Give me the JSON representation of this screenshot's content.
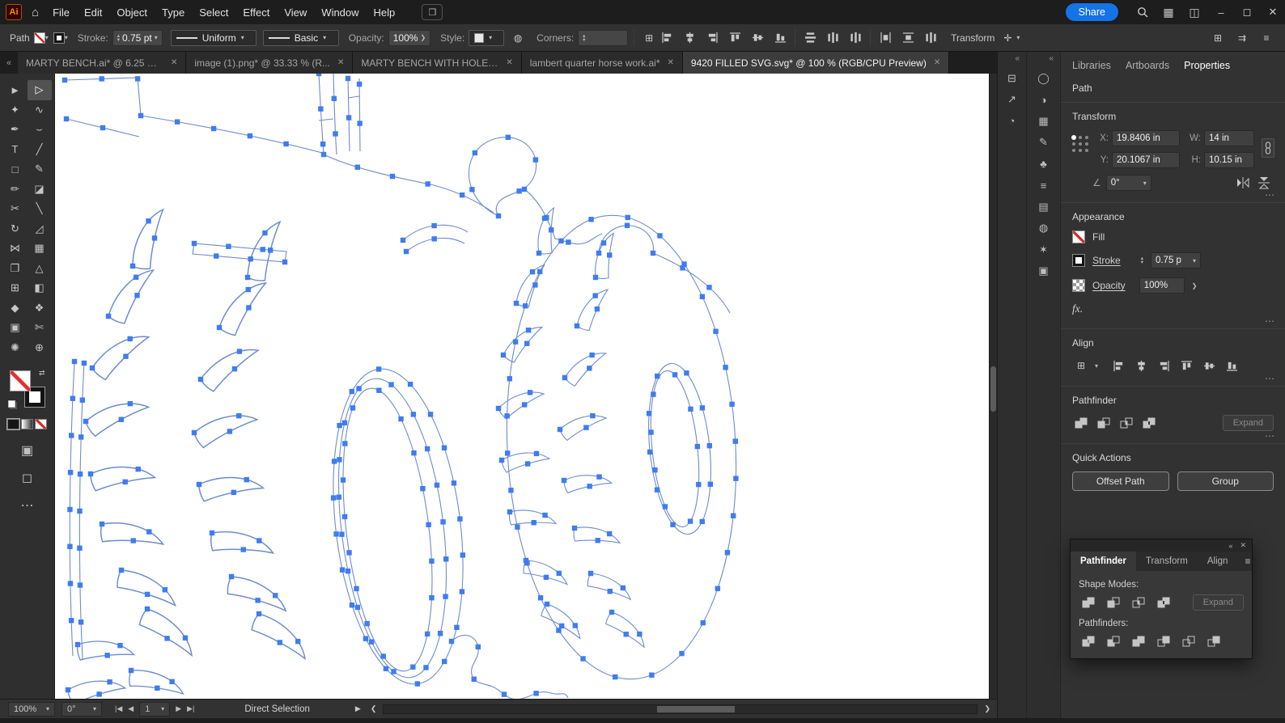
{
  "icon_glyphs": {
    "home": "⌂",
    "chevron_down": "▾",
    "up": "▴",
    "down": "▾",
    "collapse": "«",
    "more": "⋯",
    "swap": "⇄",
    "angle": "∠",
    "transform_each": "✛",
    "menu": "≡",
    "workspace": "▦",
    "panel_layout": "◫",
    "apps": "❒",
    "close": "✕",
    "grid": "⊞",
    "arrows": "⇉",
    "circle_icon": "◍",
    "first": "|◀",
    "prev": "◀",
    "next": "▶",
    "last": "▶|",
    "play": "▶",
    "scroll_left": "❮",
    "scroll_right": "❯",
    "draw_mode": "▣",
    "screen_mode": "◻"
  },
  "titlebar": {
    "logo": "Ai",
    "menus": [
      "File",
      "Edit",
      "Object",
      "Type",
      "Select",
      "Effect",
      "View",
      "Window",
      "Help"
    ],
    "share": "Share",
    "window_controls": {
      "minimize": "–",
      "maximize": "◻",
      "close": "✕"
    }
  },
  "controlbar": {
    "selection_type": "Path",
    "stroke_label": "Stroke:",
    "stroke_value": "0.75 pt",
    "width_profile": "Uniform",
    "brush": "Basic",
    "opacity_label": "Opacity:",
    "opacity_value": "100%",
    "style_label": "Style:",
    "corners_label": "Corners:",
    "transform_label": "Transform",
    "align_icons": [
      {
        "name": "align-left-icon",
        "kind": "h-left"
      },
      {
        "name": "align-center-horizontal-icon",
        "kind": "h-center"
      },
      {
        "name": "align-right-icon",
        "kind": "h-right"
      },
      {
        "name": "align-top-icon",
        "kind": "v-top"
      },
      {
        "name": "align-center-vertical-icon",
        "kind": "v-middle"
      },
      {
        "name": "align-bottom-icon",
        "kind": "v-bottom"
      }
    ],
    "distribute_icons": [
      {
        "name": "distribute-vertical-icon",
        "kind": "dist-h"
      },
      {
        "name": "distribute-horizontal-icon",
        "kind": "dist-v"
      },
      {
        "name": "distribute-center-icon",
        "kind": "dist-v"
      }
    ],
    "spacing_icons": [
      {
        "name": "horizontal-spacing-icon",
        "kind": "spacing-h"
      },
      {
        "name": "vertical-spacing-icon",
        "kind": "spacing-v"
      },
      {
        "name": "align-to-selection-icon",
        "kind": "dist-v"
      }
    ]
  },
  "tabs": [
    {
      "label": "MARTY BENCH.ai* @ 6.25 % ...",
      "close": "✕",
      "active": false
    },
    {
      "label": "image (1).png* @ 33.33 % (R...",
      "close": "✕",
      "active": false
    },
    {
      "label": "MARTY BENCH WITH HOLES.ai*",
      "close": "✕",
      "active": false
    },
    {
      "label": "lambert quarter horse work.ai*",
      "close": "✕",
      "active": false
    },
    {
      "label": "9420 FILLED SVG.svg* @ 100 % (RGB/CPU Preview)",
      "close": "✕",
      "active": true
    }
  ],
  "toolbar": {
    "tools": [
      {
        "name": "selection-tool",
        "glyph": "►",
        "active": false
      },
      {
        "name": "direct-selection-tool",
        "glyph": "▷",
        "active": true
      },
      {
        "name": "magic-wand-tool",
        "glyph": "✦",
        "active": false
      },
      {
        "name": "lasso-tool",
        "glyph": "∿",
        "active": false
      },
      {
        "name": "pen-tool",
        "glyph": "✒",
        "active": false
      },
      {
        "name": "curvature-tool",
        "glyph": "⌣",
        "active": false
      },
      {
        "name": "type-tool",
        "glyph": "T",
        "active": false
      },
      {
        "name": "line-segment-tool",
        "glyph": "╱",
        "active": false
      },
      {
        "name": "rectangle-tool",
        "glyph": "□",
        "active": false
      },
      {
        "name": "paintbrush-tool",
        "glyph": "✎",
        "active": false
      },
      {
        "name": "pencil-tool",
        "glyph": "✏",
        "active": false
      },
      {
        "name": "eraser-tool",
        "glyph": "◪",
        "active": false
      },
      {
        "name": "scissors-tool",
        "glyph": "✂",
        "active": false
      },
      {
        "name": "knife-tool",
        "glyph": "╲",
        "active": false
      },
      {
        "name": "rotate-tool",
        "glyph": "↻",
        "active": false
      },
      {
        "name": "scale-tool",
        "glyph": "◿",
        "active": false
      },
      {
        "name": "width-tool",
        "glyph": "⋈",
        "active": false
      },
      {
        "name": "free-transform-tool",
        "glyph": "▦",
        "active": false
      },
      {
        "name": "shape-builder-tool",
        "glyph": "❒",
        "active": false
      },
      {
        "name": "perspective-grid-tool",
        "glyph": "△",
        "active": false
      },
      {
        "name": "mesh-tool",
        "glyph": "⊞",
        "active": false
      },
      {
        "name": "gradient-tool",
        "glyph": "◧",
        "active": false
      },
      {
        "name": "eyedropper-tool",
        "glyph": "◆",
        "active": false
      },
      {
        "name": "blend-tool",
        "glyph": "❖",
        "active": false
      },
      {
        "name": "artboard-tool",
        "glyph": "▣",
        "active": false
      },
      {
        "name": "slice-tool",
        "glyph": "✄",
        "active": false
      },
      {
        "name": "hand-tool",
        "glyph": "✺",
        "active": false
      },
      {
        "name": "zoom-tool",
        "glyph": "⊕",
        "active": false
      }
    ]
  },
  "side_strips": {
    "strip1": [
      {
        "name": "stacked-panels-icon",
        "glyph": "⊟"
      },
      {
        "name": "asset-export-icon",
        "glyph": "↗"
      },
      {
        "name": "color-wheel-icon",
        "glyph": "◔"
      }
    ],
    "strip2": [
      {
        "name": "color-panel-icon",
        "glyph": "◯"
      },
      {
        "name": "gradient-panel-icon",
        "glyph": "◑"
      },
      {
        "name": "swatches-panel-icon",
        "glyph": "▦"
      },
      {
        "name": "brushes-panel-icon",
        "glyph": "✎"
      },
      {
        "name": "symbols-panel-icon",
        "glyph": "♣"
      },
      {
        "name": "stroke-panel-icon",
        "glyph": "≡"
      },
      {
        "name": "appearance-panel-icon",
        "glyph": "▤"
      },
      {
        "name": "transparency-panel-icon",
        "glyph": "◍"
      },
      {
        "name": "effects-panel-icon",
        "glyph": "✶"
      },
      {
        "name": "layers-panel-icon",
        "glyph": "▣"
      }
    ]
  },
  "panels": {
    "tabs": [
      "Libraries",
      "Artboards",
      "Properties"
    ],
    "active_tab": "Properties",
    "selection_header": "Path",
    "transform": {
      "header": "Transform",
      "x_label": "X:",
      "x": "19.8406 in",
      "y_label": "Y:",
      "y": "20.1067 in",
      "w_label": "W:",
      "w": "14 in",
      "h_label": "H:",
      "h": "10.15 in",
      "angle": "0°"
    },
    "appearance": {
      "header": "Appearance",
      "fill_label": "Fill",
      "stroke_label": "Stroke",
      "stroke_value": "0.75 p",
      "opacity_label": "Opacity",
      "opacity_value": "100%",
      "fx": "fx."
    },
    "align": {
      "header": "Align",
      "icons": [
        {
          "name": "align-left-icon",
          "kind": "h-left"
        },
        {
          "name": "align-center-horizontal-icon",
          "kind": "h-center"
        },
        {
          "name": "align-right-icon",
          "kind": "h-right"
        },
        {
          "name": "align-top-icon",
          "kind": "v-top"
        },
        {
          "name": "align-center-vertical-icon",
          "kind": "v-middle"
        },
        {
          "name": "align-bottom-icon",
          "kind": "v-bottom"
        }
      ]
    },
    "pathfinder": {
      "header": "Pathfinder",
      "expand": "Expand",
      "shape_modes": [
        {
          "name": "unite-icon",
          "kind": "unite"
        },
        {
          "name": "minus-front-icon",
          "kind": "minus-front"
        },
        {
          "name": "intersect-icon",
          "kind": "intersect"
        },
        {
          "name": "exclude-icon",
          "kind": "exclude"
        }
      ]
    },
    "quick_actions": {
      "header": "Quick Actions",
      "buttons": [
        "Offset Path",
        "Group"
      ]
    }
  },
  "floating_panel": {
    "tabs": [
      "Pathfinder",
      "Transform",
      "Align"
    ],
    "active_tab": "Pathfinder",
    "shape_modes_label": "Shape Modes:",
    "expand": "Expand",
    "pathfinders_label": "Pathfinders:",
    "shape_modes": [
      {
        "name": "unite-icon",
        "kind": "unite"
      },
      {
        "name": "minus-front-icon",
        "kind": "minus-front"
      },
      {
        "name": "intersect-icon",
        "kind": "intersect"
      },
      {
        "name": "exclude-icon",
        "kind": "exclude"
      }
    ],
    "pathfinders": [
      {
        "name": "divide-icon",
        "kind": "divide"
      },
      {
        "name": "trim-icon",
        "kind": "trim"
      },
      {
        "name": "merge-icon",
        "kind": "merge"
      },
      {
        "name": "crop-icon",
        "kind": "crop"
      },
      {
        "name": "outline-icon",
        "kind": "outline"
      },
      {
        "name": "minus-back-icon",
        "kind": "minus-back"
      }
    ]
  },
  "statusbar": {
    "zoom": "100%",
    "rotation": "0°",
    "artboard_value": "1",
    "tool": "Direct Selection"
  }
}
